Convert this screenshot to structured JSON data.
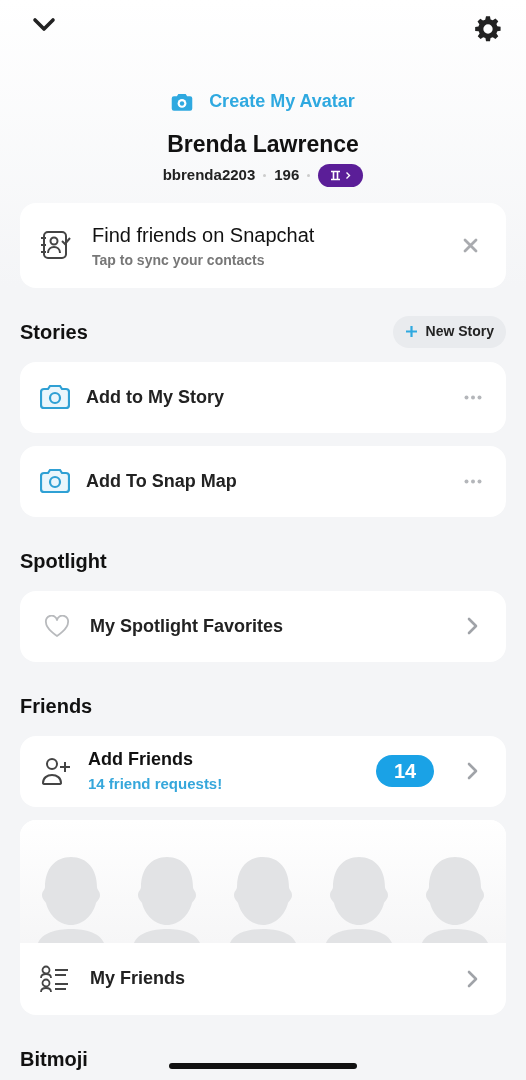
{
  "profile": {
    "create_avatar": "Create My Avatar",
    "name": "Brenda Lawrence",
    "username": "bbrenda2203",
    "score": "196"
  },
  "find_friends": {
    "title": "Find friends on Snapchat",
    "subtitle": "Tap to sync your contacts"
  },
  "sections": [
    {
      "title": "Stories",
      "action": "New Story",
      "items": [
        {
          "kind": "story",
          "label": "Add to My Story"
        },
        {
          "kind": "story",
          "label": "Add To Snap Map"
        }
      ]
    },
    {
      "title": "Spotlight",
      "items": [
        {
          "kind": "favorites",
          "label": "My Spotlight Favorites"
        }
      ]
    },
    {
      "title": "Friends",
      "items": [
        {
          "kind": "add_friends",
          "label": "Add Friends",
          "subtitle": "14 friend requests!",
          "badge": "14"
        },
        {
          "kind": "my_friends",
          "label": "My Friends"
        }
      ]
    },
    {
      "title": "Bitmoji"
    }
  ]
}
